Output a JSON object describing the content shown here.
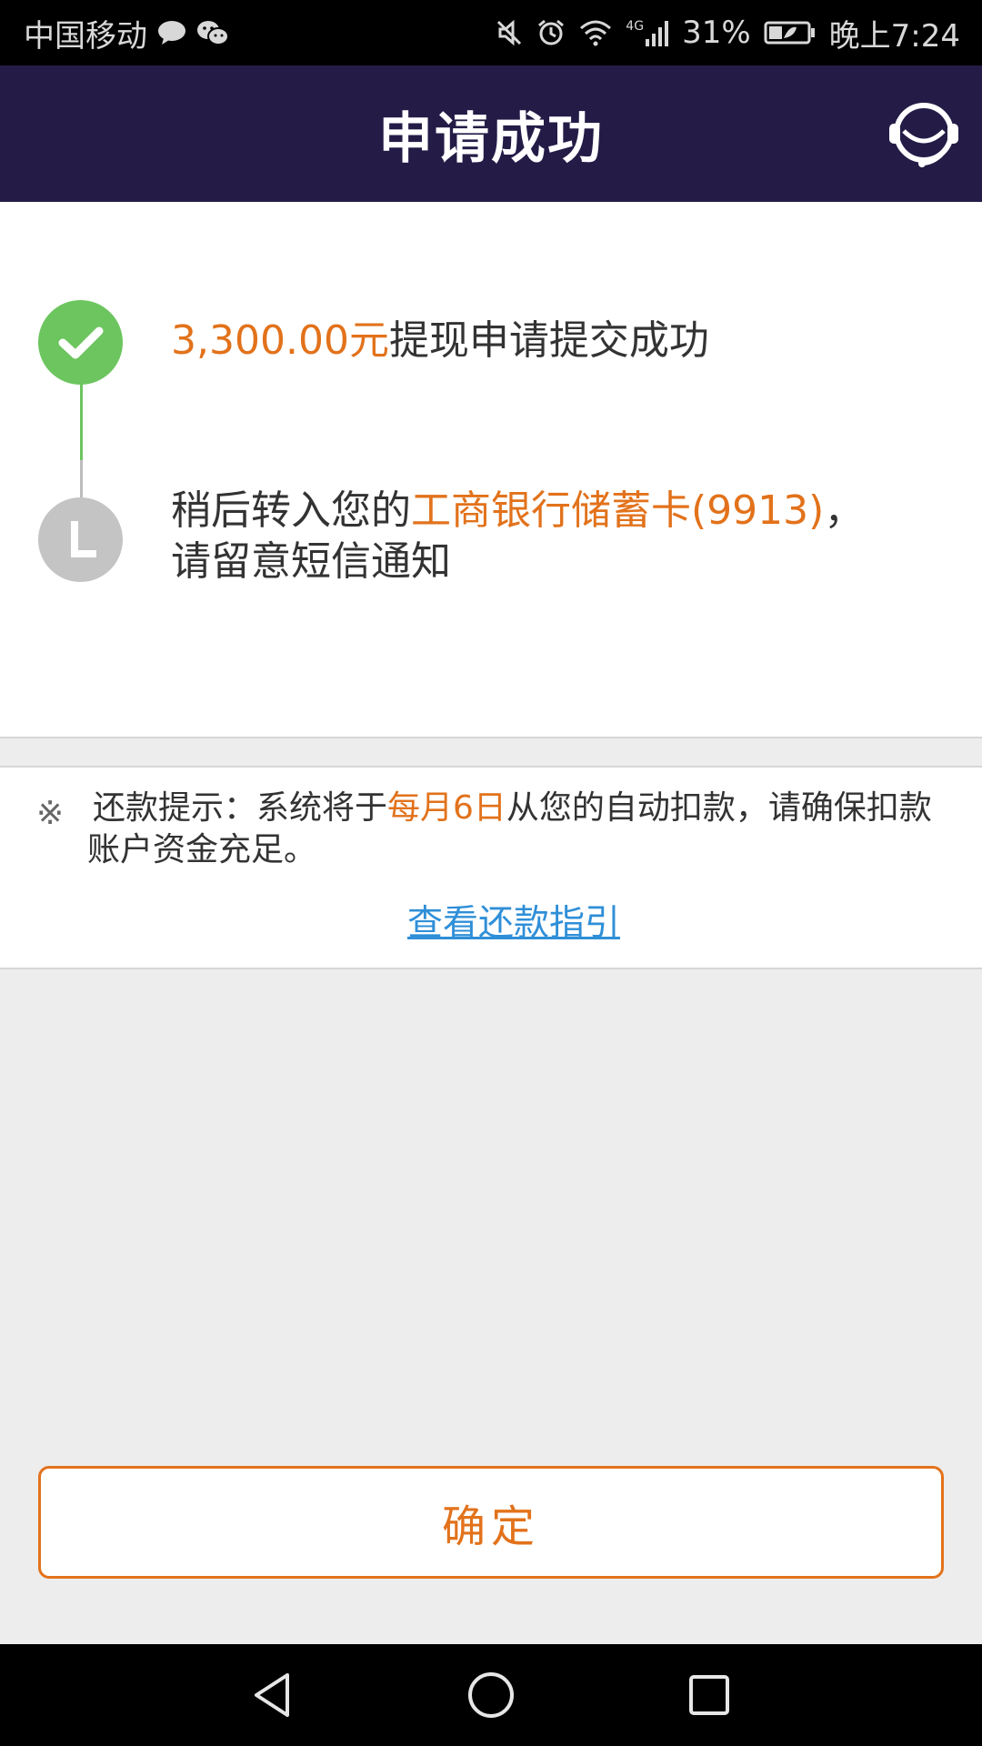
{
  "status_bar": {
    "carrier": "中国移动",
    "network": "4G",
    "battery": "31%",
    "time": "晚上7:24",
    "icons": [
      "message-icon",
      "wechat-icon",
      "mute-icon",
      "alarm-icon",
      "wifi-icon",
      "signal-icon",
      "battery-icon"
    ]
  },
  "header": {
    "title": "申请成功",
    "service_icon": "customer-service-icon",
    "bg_color": "#241c47"
  },
  "steps": [
    {
      "status": "done",
      "amount": "3,300.00元",
      "text": "提现申请提交成功",
      "color": "#6cc55e"
    },
    {
      "status": "pending",
      "prefix": "稍后转入您的",
      "bank": "工商银行储蓄卡(9913)",
      "suffix": "，",
      "line2": "请留意短信通知",
      "color": "#c4c4c4"
    }
  ],
  "notice": {
    "mark": "※",
    "prefix": "还款提示：系统将于",
    "date": "每月6日",
    "suffix": "从您的自动扣款，请确保扣款账户资金充足。",
    "link": "查看还款指引"
  },
  "confirm_button": "确定",
  "colors": {
    "accent": "#e2721b",
    "link": "#2f8fd8",
    "success": "#6cc55e"
  }
}
